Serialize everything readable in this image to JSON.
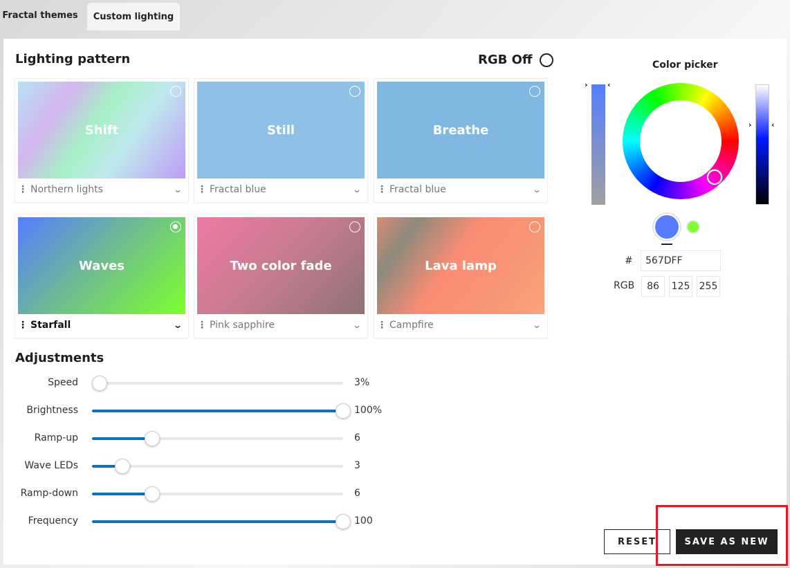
{
  "tabs": [
    {
      "label": "Fractal themes",
      "active": false
    },
    {
      "label": "Custom lighting",
      "active": true
    }
  ],
  "lighting": {
    "title": "Lighting pattern",
    "rgb_off_label": "RGB Off",
    "cards": [
      {
        "name": "Shift",
        "preset": "Northern lights",
        "selected": false,
        "bg": "linear-gradient(125deg,#b6e3f4 0%,#d3b5ef 25%,#a6f0c6 45%,#bfe9ee 65%,#bf9bf6 100%)"
      },
      {
        "name": "Still",
        "preset": "Fractal blue",
        "selected": false,
        "bg": "#8fc1e6"
      },
      {
        "name": "Breathe",
        "preset": "Fractal blue",
        "selected": false,
        "bg": "#80b8e2"
      },
      {
        "name": "Waves",
        "preset": "Starfall",
        "selected": true,
        "bg": "linear-gradient(135deg,#567dff 0%,#6fbf8a 50%,#7dff2d 100%)"
      },
      {
        "name": "Two color fade",
        "preset": "Pink sapphire",
        "selected": false,
        "bg": "linear-gradient(135deg,#f07aa6 0%,#c57b8e 50%,#8d7376 100%)"
      },
      {
        "name": "Lava lamp",
        "preset": "Campfire",
        "selected": false,
        "bg": "linear-gradient(125deg,#d88c74 0%,#8e8a7c 18%,#fb8c74 45%,#f79676 75%,#fba37c 100%)"
      }
    ]
  },
  "adjustments": {
    "title": "Adjustments",
    "rows": [
      {
        "label": "Speed",
        "value": "3%",
        "fraction": 0.03
      },
      {
        "label": "Brightness",
        "value": "100%",
        "fraction": 1.0
      },
      {
        "label": "Ramp-up",
        "value": "6",
        "fraction": 0.24
      },
      {
        "label": "Wave LEDs",
        "value": "3",
        "fraction": 0.12
      },
      {
        "label": "Ramp-down",
        "value": "6",
        "fraction": 0.24
      },
      {
        "label": "Frequency",
        "value": "100",
        "fraction": 1.0
      }
    ]
  },
  "picker": {
    "title": "Color picker",
    "hex_label": "#",
    "hex": "567DFF",
    "rgb_label": "RGB",
    "r": "86",
    "g": "125",
    "b": "255",
    "color_primary": "#567DFF",
    "color_secondary": "#7DFF2D"
  },
  "actions": {
    "reset": "RESET",
    "save_as_new": "SAVE AS NEW"
  },
  "colors": {
    "accent": "#0A72C4",
    "highlight": "#E21A24"
  }
}
